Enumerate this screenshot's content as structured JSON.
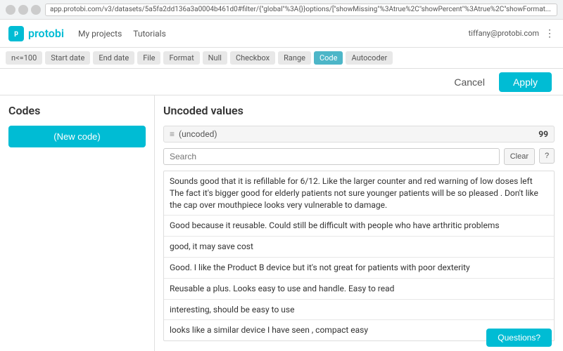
{
  "browser": {
    "url": "app.protobi.com/v3/datasets/5a5fa2dd136a3a0004b461d0#filter/{\"global\"%3A{}}options/[\"showMissing\"%3Atrue%2C\"showPercent\"%3Atrue%2C\"showFormat..."
  },
  "app_header": {
    "logo_text": "protobi",
    "nav": {
      "my_projects": "My projects",
      "tutorials": "Tutorials"
    },
    "user_email": "tiffany@protobi.com"
  },
  "filter_tabs": [
    {
      "label": "n<=100",
      "active": false
    },
    {
      "label": "Start date",
      "active": false
    },
    {
      "label": "End date",
      "active": false
    },
    {
      "label": "File",
      "active": false
    },
    {
      "label": "Format",
      "active": false
    },
    {
      "label": "Null",
      "active": false
    },
    {
      "label": "Checkbox",
      "active": false
    },
    {
      "label": "Range",
      "active": false
    },
    {
      "label": "Code",
      "active": true
    },
    {
      "label": "Autocoder",
      "active": false
    }
  ],
  "action_bar": {
    "cancel_label": "Cancel",
    "apply_label": "Apply"
  },
  "codes_panel": {
    "title": "Codes",
    "new_code_label": "(New code)"
  },
  "uncoded_panel": {
    "title": "Uncoded values",
    "uncoded_label": "(uncoded)",
    "uncoded_count": "99",
    "search_placeholder": "Search",
    "clear_label": "Clear",
    "help_label": "?",
    "values": [
      "Sounds good that it is refillable for 6/12. Like the larger counter and red warning of low doses left The fact it's bigger good for elderly patients not sure younger patients will be so pleased . Don't like the cap over mouthpiece looks very vulnerable to damage.",
      "Good because it reusable. Could still be difficult with people who have arthritic problems",
      "good, it may save cost",
      "Good. I like the Product B device but it's not great for patients with poor dexterity",
      "Reusable a plus. Looks easy to use and handle. Easy to read",
      "interesting, should be easy to use",
      "looks like a similar device I have seen , compact easy"
    ]
  },
  "bottom": {
    "questions_label": "Questions?"
  }
}
